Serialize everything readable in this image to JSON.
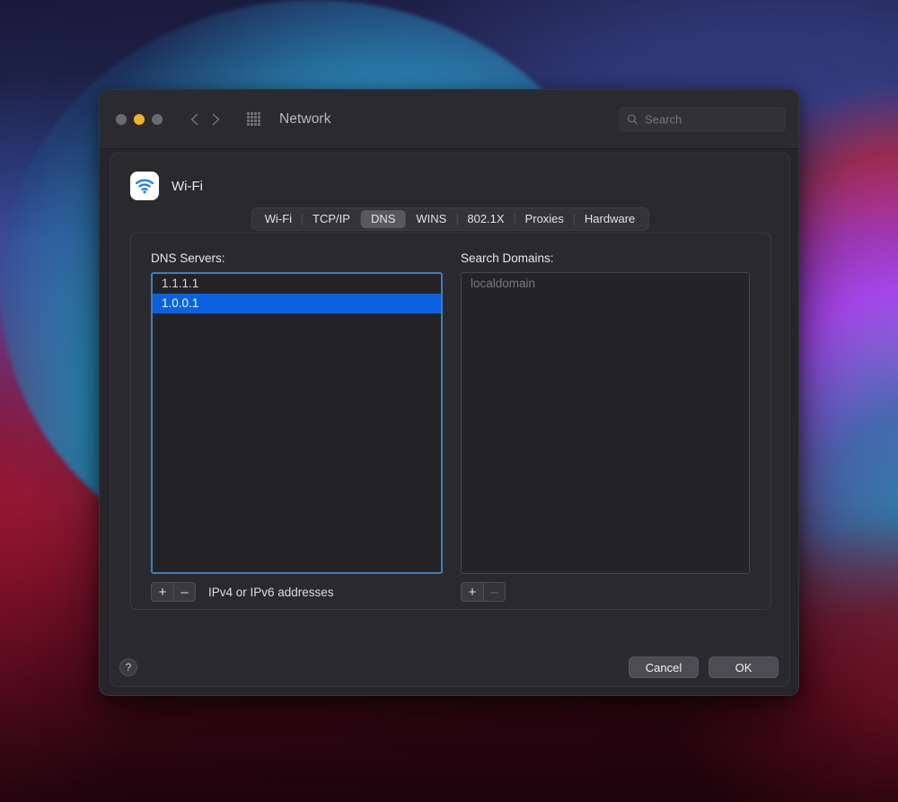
{
  "window": {
    "title": "Network",
    "traffic_lights": [
      "close",
      "minimize",
      "zoom"
    ],
    "nav": {
      "back": "back-chevron",
      "forward": "forward-chevron",
      "grid": "show-all-grid"
    },
    "search": {
      "placeholder": "Search",
      "value": "",
      "icon": "search-icon"
    }
  },
  "sheet": {
    "service_name": "Wi-Fi",
    "service_icon": "wifi-icon",
    "tabs": [
      {
        "label": "Wi-Fi",
        "selected": false
      },
      {
        "label": "TCP/IP",
        "selected": false
      },
      {
        "label": "DNS",
        "selected": true
      },
      {
        "label": "WINS",
        "selected": false
      },
      {
        "label": "802.1X",
        "selected": false
      },
      {
        "label": "Proxies",
        "selected": false
      },
      {
        "label": "Hardware",
        "selected": false
      }
    ],
    "dns": {
      "label": "DNS Servers:",
      "servers": [
        {
          "value": "1.1.1.1",
          "selected": false
        },
        {
          "value": "1.0.0.1",
          "selected": true
        }
      ],
      "add_label": "+",
      "remove_label": "–",
      "hint": "IPv4 or IPv6 addresses"
    },
    "search_domains": {
      "label": "Search Domains:",
      "entries": [
        {
          "value": "localdomain",
          "placeholder": true
        }
      ],
      "add_label": "+",
      "remove_label": "–",
      "remove_disabled": true
    },
    "footer": {
      "help_label": "?",
      "cancel_label": "Cancel",
      "ok_label": "OK"
    }
  },
  "colors": {
    "selection_blue": "#0a62e0",
    "focus_ring": "#3d7ebd",
    "window_bg": "#26262a",
    "sheet_bg": "#2a2a2e",
    "minimize_yellow": "#f5b229"
  }
}
